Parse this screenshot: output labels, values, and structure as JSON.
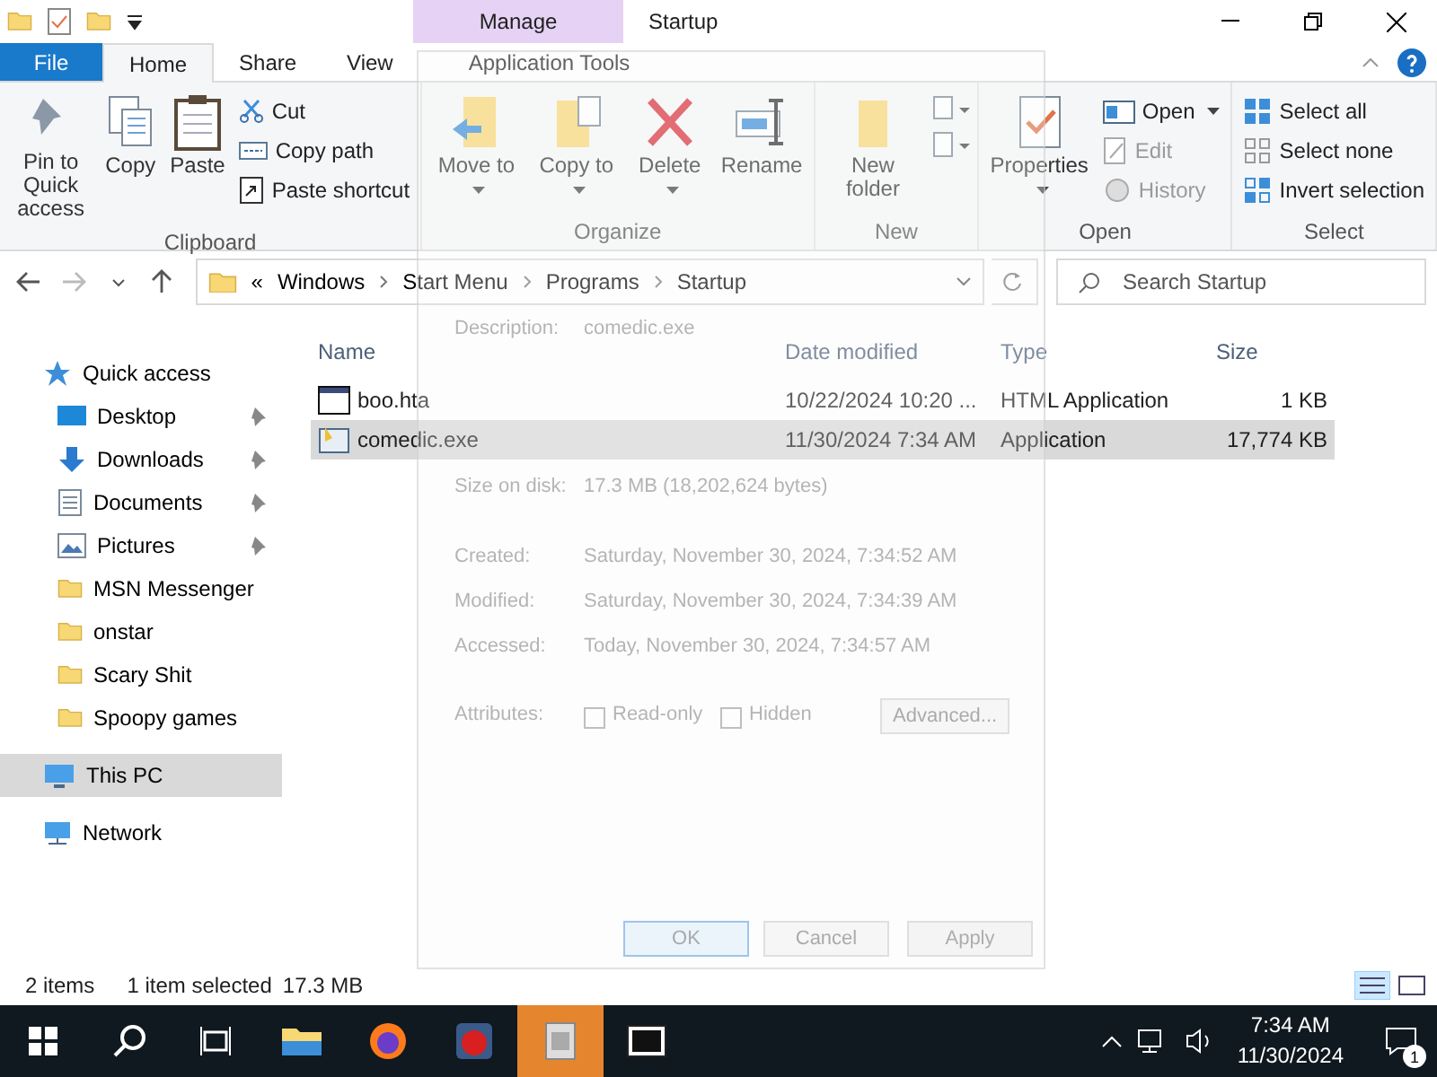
{
  "title_bar": {
    "contextual_tab": "Manage",
    "title": "Startup"
  },
  "ribbon_tabs": [
    {
      "label": "File",
      "kind": "file",
      "selected": false
    },
    {
      "label": "Home",
      "kind": "normal",
      "selected": true
    },
    {
      "label": "Share",
      "kind": "normal",
      "selected": false
    },
    {
      "label": "View",
      "kind": "normal",
      "selected": false
    },
    {
      "label": "Application Tools",
      "kind": "contextual",
      "selected": false
    }
  ],
  "ribbon_groups": [
    {
      "name": "Clipboard",
      "large": [
        {
          "label": "Pin to Quick access",
          "dropdown": false,
          "disabled": false
        },
        {
          "label": "Copy",
          "dropdown": false,
          "disabled": false
        },
        {
          "label": "Paste",
          "dropdown": false,
          "disabled": false
        }
      ],
      "small": [
        {
          "label": "Cut",
          "dropdown": false,
          "disabled": false
        },
        {
          "label": "Copy path",
          "dropdown": false,
          "disabled": false
        },
        {
          "label": "Paste shortcut",
          "dropdown": false,
          "disabled": false
        }
      ]
    },
    {
      "name": "Organize",
      "large": [
        {
          "label": "Move to",
          "dropdown": true,
          "disabled": false
        },
        {
          "label": "Copy to",
          "dropdown": true,
          "disabled": false
        },
        {
          "label": "Delete",
          "dropdown": true,
          "disabled": false
        },
        {
          "label": "Rename",
          "dropdown": false,
          "disabled": false
        }
      ]
    },
    {
      "name": "New",
      "large": [
        {
          "label": "New folder",
          "dropdown": false,
          "disabled": false
        }
      ]
    },
    {
      "name": "Open",
      "large": [
        {
          "label": "Properties",
          "dropdown": true,
          "disabled": false
        }
      ],
      "small": [
        {
          "label": "Open",
          "dropdown": true,
          "disabled": false
        },
        {
          "label": "Edit",
          "dropdown": false,
          "disabled": true
        },
        {
          "label": "History",
          "dropdown": false,
          "disabled": true
        }
      ]
    },
    {
      "name": "Select",
      "small": [
        {
          "label": "Select all",
          "dropdown": false,
          "disabled": false
        },
        {
          "label": "Select none",
          "dropdown": false,
          "disabled": false
        },
        {
          "label": "Invert selection",
          "dropdown": false,
          "disabled": false
        }
      ]
    }
  ],
  "address_bar": {
    "overflow": "«",
    "path": [
      "Windows",
      "Start Menu",
      "Programs",
      "Startup"
    ]
  },
  "search": {
    "placeholder": "Search Startup"
  },
  "navigation": [
    {
      "label": "Quick access",
      "selected": false,
      "children": [
        {
          "label": "Desktop",
          "selected": false,
          "pinned": true
        },
        {
          "label": "Downloads",
          "selected": false,
          "pinned": true
        },
        {
          "label": "Documents",
          "selected": false,
          "pinned": true
        },
        {
          "label": "Pictures",
          "selected": false,
          "pinned": true
        },
        {
          "label": "MSN Messenger",
          "selected": false,
          "pinned": false
        },
        {
          "label": "onstar",
          "selected": false,
          "pinned": false
        },
        {
          "label": "Scary Shit",
          "selected": false,
          "pinned": false
        },
        {
          "label": "Spoopy games",
          "selected": false,
          "pinned": false
        }
      ]
    },
    {
      "label": "This PC",
      "selected": true
    },
    {
      "label": "Network",
      "selected": false
    }
  ],
  "table": {
    "columns": [
      "Name",
      "Date modified",
      "Type",
      "Size"
    ],
    "rows": [
      {
        "name": "boo.hta",
        "date_modified": "10/22/2024 10:20 ...",
        "type": "HTML Application",
        "size": "1 KB",
        "selected": false
      },
      {
        "name": "comedic.exe",
        "date_modified": "11/30/2024 7:34 AM",
        "type": "Application",
        "size": "17,774 KB",
        "selected": true
      }
    ]
  },
  "dialog": {
    "description_label": "Description:",
    "description": "comedic.exe",
    "fields": [
      {
        "label": "Size on disk:",
        "value": "17.3 MB (18,202,624 bytes)"
      },
      {
        "label": "Created:",
        "value": "Saturday, November 30, 2024, 7:34:52 AM"
      },
      {
        "label": "Modified:",
        "value": "Saturday, November 30, 2024, 7:34:39 AM"
      },
      {
        "label": "Accessed:",
        "value": "Today, November 30, 2024, 7:34:57 AM"
      }
    ],
    "attributes_label": "Attributes:",
    "attributes": [
      {
        "label": "Read-only",
        "checked": false
      },
      {
        "label": "Hidden",
        "checked": false
      }
    ],
    "advanced": "Advanced...",
    "buttons": [
      {
        "label": "OK",
        "kind": "default"
      },
      {
        "label": "Cancel",
        "kind": "normal"
      },
      {
        "label": "Apply",
        "kind": "disabled"
      }
    ]
  },
  "status_bar": {
    "count": "2 items",
    "selection": "1 item selected",
    "size": "17.3 MB"
  },
  "taskbar": {
    "apps": [
      {
        "flashing": false
      },
      {
        "flashing": false
      },
      {
        "flashing": false
      },
      {
        "flashing": true
      },
      {
        "flashing": false
      }
    ],
    "time": "7:34 AM",
    "date": "11/30/2024",
    "notifications": "1"
  }
}
